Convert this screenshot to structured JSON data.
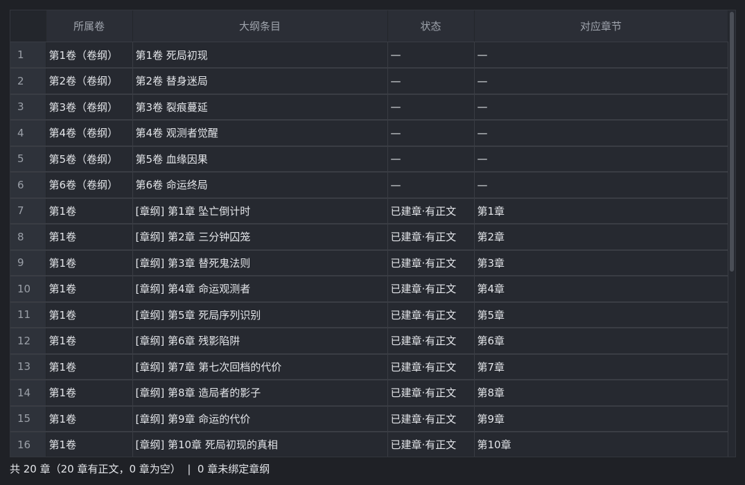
{
  "table": {
    "columns": [
      "所属卷",
      "大纲条目",
      "状态",
      "对应章节"
    ],
    "rows": [
      {
        "num": "1",
        "volume": "第1卷（卷纲）",
        "item": "第1卷 死局初现",
        "status": "—",
        "chapter": "—"
      },
      {
        "num": "2",
        "volume": "第2卷（卷纲）",
        "item": "第2卷 替身迷局",
        "status": "—",
        "chapter": "—"
      },
      {
        "num": "3",
        "volume": "第3卷（卷纲）",
        "item": "第3卷 裂痕蔓延",
        "status": "—",
        "chapter": "—"
      },
      {
        "num": "4",
        "volume": "第4卷（卷纲）",
        "item": "第4卷 观测者觉醒",
        "status": "—",
        "chapter": "—"
      },
      {
        "num": "5",
        "volume": "第5卷（卷纲）",
        "item": "第5卷 血缘因果",
        "status": "—",
        "chapter": "—"
      },
      {
        "num": "6",
        "volume": "第6卷（卷纲）",
        "item": "第6卷 命运终局",
        "status": "—",
        "chapter": "—"
      },
      {
        "num": "7",
        "volume": "第1卷",
        "item": "[章纲] 第1章 坠亡倒计时",
        "status": "已建章·有正文",
        "chapter": "第1章"
      },
      {
        "num": "8",
        "volume": "第1卷",
        "item": "[章纲] 第2章 三分钟囚笼",
        "status": "已建章·有正文",
        "chapter": "第2章"
      },
      {
        "num": "9",
        "volume": "第1卷",
        "item": "[章纲] 第3章 替死鬼法则",
        "status": "已建章·有正文",
        "chapter": "第3章"
      },
      {
        "num": "10",
        "volume": "第1卷",
        "item": "[章纲] 第4章 命运观测者",
        "status": "已建章·有正文",
        "chapter": "第4章"
      },
      {
        "num": "11",
        "volume": "第1卷",
        "item": "[章纲] 第5章 死局序列识别",
        "status": "已建章·有正文",
        "chapter": "第5章"
      },
      {
        "num": "12",
        "volume": "第1卷",
        "item": "[章纲] 第6章 残影陷阱",
        "status": "已建章·有正文",
        "chapter": "第6章"
      },
      {
        "num": "13",
        "volume": "第1卷",
        "item": "[章纲] 第7章 第七次回档的代价",
        "status": "已建章·有正文",
        "chapter": "第7章"
      },
      {
        "num": "14",
        "volume": "第1卷",
        "item": "[章纲] 第8章 造局者的影子",
        "status": "已建章·有正文",
        "chapter": "第8章"
      },
      {
        "num": "15",
        "volume": "第1卷",
        "item": "[章纲] 第9章 命运的代价",
        "status": "已建章·有正文",
        "chapter": "第9章"
      },
      {
        "num": "16",
        "volume": "第1卷",
        "item": "[章纲] 第10章 死局初现的真相",
        "status": "已建章·有正文",
        "chapter": "第10章"
      }
    ]
  },
  "footer": {
    "summary": "共 20 章（20 章有正文，0 章为空）  |  0 章未绑定章纲"
  }
}
